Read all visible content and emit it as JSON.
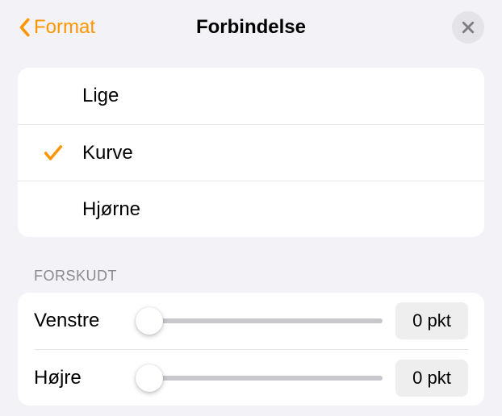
{
  "header": {
    "back_label": "Format",
    "title": "Forbindelse"
  },
  "connection_types": {
    "items": [
      {
        "label": "Lige",
        "selected": false
      },
      {
        "label": "Kurve",
        "selected": true
      },
      {
        "label": "Hjørne",
        "selected": false
      }
    ]
  },
  "offset": {
    "section_label": "FORSKUDT",
    "rows": [
      {
        "label": "Venstre",
        "value": 0,
        "display": "0 pkt"
      },
      {
        "label": "Højre",
        "value": 0,
        "display": "0 pkt"
      }
    ]
  }
}
